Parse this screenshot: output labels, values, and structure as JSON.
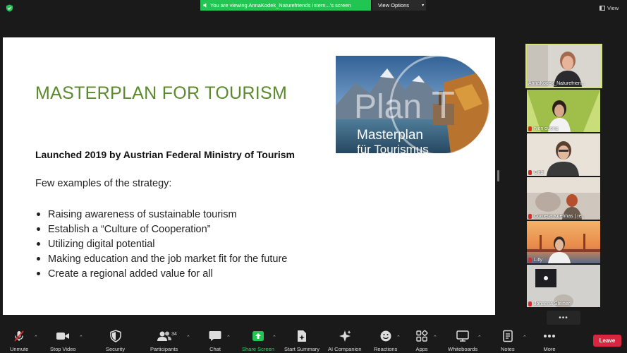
{
  "topbar": {
    "share_banner": "You are viewing AnnaKodek_Naturefriends Intern...'s screen",
    "view_options": "View Options",
    "view_label": "View"
  },
  "slide": {
    "title": "MASTERPLAN FOR TOURISM",
    "subtitle": "Launched 2019 by Austrian Federal Ministry of Tourism",
    "intro": "Few examples of the strategy:",
    "bullets": [
      "Raising awareness of sustainable tourism",
      "Establish a “Culture of Cooperation”",
      "Utilizing digital potential",
      "Making education and the job market fit for the future",
      "Create a regional added value for all"
    ],
    "logo_text": {
      "brand": "Plan",
      "brand_letter": "T",
      "line1": "Masterplan",
      "line2": "für Tourismus"
    }
  },
  "participants_gallery": [
    {
      "name": "AnnaKodek_Naturefrien..."
    },
    {
      "name": "hien duong"
    },
    {
      "name": "Gabi"
    },
    {
      "name": "Cornelia Kuehhas | re..."
    },
    {
      "name": "Lilly"
    },
    {
      "name": "Johanna Steiner"
    }
  ],
  "gallery_more": "•••",
  "toolbar": {
    "unmute": "Unmute",
    "stop_video": "Stop Video",
    "security": "Security",
    "participants": "Participants",
    "participants_count": "34",
    "chat": "Chat",
    "share_screen": "Share Screen",
    "start_summary": "Start Summary",
    "ai_companion": "AI Companion",
    "reactions": "Reactions",
    "apps": "Apps",
    "whiteboards": "Whiteboards",
    "notes": "Notes",
    "more": "More",
    "leave": "Leave"
  },
  "colors": {
    "share_green": "#23c552",
    "title_green": "#5b8a2e",
    "leave_red": "#d7263d",
    "active_speaker_border": "#d6e36b"
  }
}
